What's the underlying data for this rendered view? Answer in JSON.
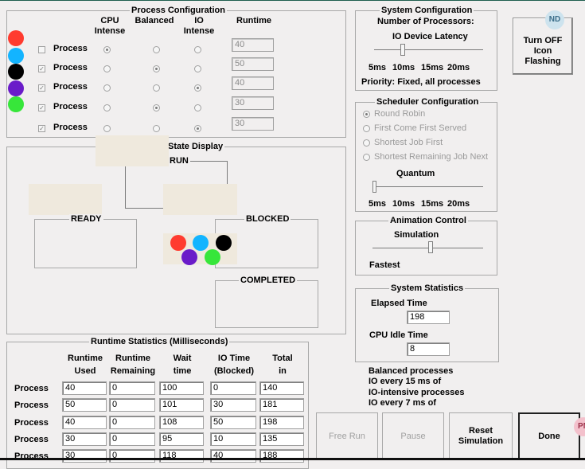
{
  "process_config": {
    "title": "Process Configuration",
    "col_cpu": "CPU Intense",
    "col_balanced": "Balanced",
    "col_io": "IO Intense",
    "col_runtime": "Runtime",
    "row_label": "Process",
    "rows": [
      {
        "color": "#ff3b2f",
        "checked": false,
        "selection": "cpu",
        "runtime": "40"
      },
      {
        "color": "#13b4ff",
        "checked": true,
        "selection": "balanced",
        "runtime": "50"
      },
      {
        "color": "#000000",
        "checked": true,
        "selection": "io",
        "runtime": "40"
      },
      {
        "color": "#6a1cc9",
        "checked": true,
        "selection": "balanced",
        "runtime": "30"
      },
      {
        "color": "#37e63a",
        "checked": true,
        "selection": "io",
        "runtime": "30"
      }
    ]
  },
  "state_display": {
    "title": "State Display",
    "run": "RUN",
    "ready": "READY",
    "blocked": "BLOCKED",
    "completed": "COMPLETED",
    "blocked_dots": [
      "#ff3b2f",
      "#13b4ff",
      "#000000",
      "#6a1cc9",
      "#37e63a"
    ]
  },
  "system_config": {
    "title": "System Configuration",
    "processors_label": "Number of Processors:",
    "latency_label": "IO Device Latency",
    "ticks": [
      "5ms",
      "10ms",
      "15ms",
      "20ms"
    ],
    "priority": "Priority: Fixed, all processes"
  },
  "scheduler": {
    "title": "Scheduler Configuration",
    "options": [
      "Round Robin",
      "First Come First Served",
      "Shortest Job First",
      "Shortest Remaining Job Next"
    ],
    "selected": 0,
    "quantum_label": "Quantum",
    "ticks": [
      "5ms",
      "10ms",
      "15ms",
      "20ms"
    ]
  },
  "animation": {
    "title": "Animation Control",
    "simulation_label": "Simulation",
    "fastest_label": "Fastest"
  },
  "system_stats": {
    "title": "System Statistics",
    "elapsed_label": "Elapsed Time",
    "elapsed_value": "198",
    "idle_label": "CPU Idle Time",
    "idle_value": "8"
  },
  "notes": {
    "line1": "Balanced processes",
    "line2": "IO every 15 ms of",
    "line3": "IO-intensive processes",
    "line4": "IO every 7 ms of"
  },
  "runtime_stats": {
    "title": "Runtime Statistics (Milliseconds)",
    "headers": [
      {
        "l1": "Runtime",
        "l2": "Used"
      },
      {
        "l1": "Runtime",
        "l2": "Remaining"
      },
      {
        "l1": "Wait",
        "l2": "time"
      },
      {
        "l1": "IO Time",
        "l2": "(Blocked)"
      },
      {
        "l1": "Total",
        "l2": "in"
      }
    ],
    "row_label": "Process",
    "rows": [
      [
        "40",
        "0",
        "100",
        "0",
        "140"
      ],
      [
        "50",
        "0",
        "101",
        "30",
        "181"
      ],
      [
        "40",
        "0",
        "108",
        "50",
        "198"
      ],
      [
        "30",
        "0",
        "95",
        "10",
        "135"
      ],
      [
        "30",
        "0",
        "118",
        "40",
        "188"
      ]
    ]
  },
  "buttons": {
    "free_run": "Free Run",
    "pause": "Pause",
    "reset": "Reset Simulation",
    "done": "Done",
    "turn_off": "Turn OFF Icon Flashing"
  },
  "badges": {
    "nd": "ND",
    "pn": "PN"
  }
}
